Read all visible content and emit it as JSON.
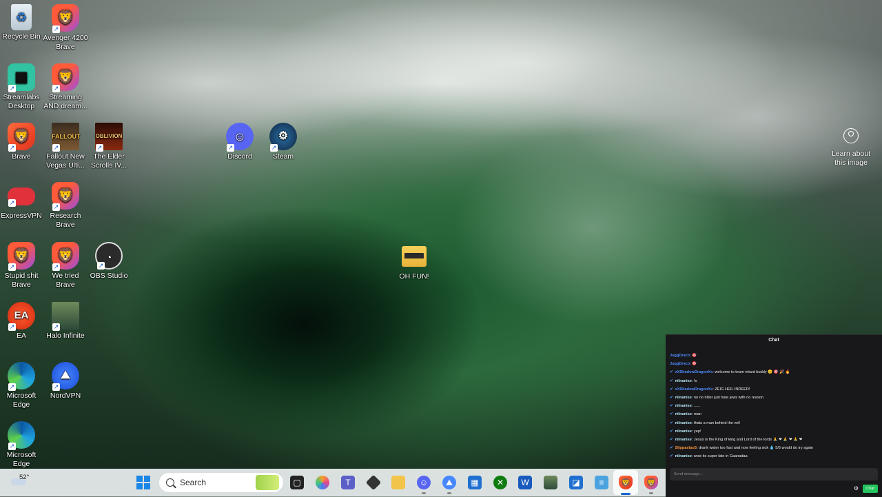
{
  "desktop": {
    "icons": [
      {
        "label": "Recycle Bin",
        "icon": "recycle-bin-icon"
      },
      {
        "label": "Avenger 4200 Brave",
        "icon": "brave-profile-icon"
      },
      {
        "label": "Streamlabs Desktop",
        "icon": "streamlabs-icon"
      },
      {
        "label": "Streaming AND dream...",
        "icon": "brave-profile-icon"
      },
      {
        "label": "Brave",
        "icon": "brave-icon"
      },
      {
        "label": "Fallout New Vegas Ulti...",
        "icon": "fallout-icon"
      },
      {
        "label": "The Elder Scrolls IV...",
        "icon": "oblivion-icon"
      },
      {
        "label": "ExpressVPN",
        "icon": "expressvpn-icon"
      },
      {
        "label": "Research Brave",
        "icon": "brave-profile-icon"
      },
      {
        "label": "Stupid shit Brave",
        "icon": "brave-profile-icon"
      },
      {
        "label": "We tried Brave",
        "icon": "brave-profile-icon"
      },
      {
        "label": "OBS Studio",
        "icon": "obs-icon"
      },
      {
        "label": "EA",
        "icon": "ea-icon"
      },
      {
        "label": "Halo Infinite",
        "icon": "halo-icon"
      },
      {
        "label": "Microsoft Edge",
        "icon": "edge-icon"
      },
      {
        "label": "NordVPN",
        "icon": "nordvpn-icon"
      },
      {
        "label": "Microsoft Edge",
        "icon": "edge-icon"
      },
      {
        "label": "Discord",
        "icon": "discord-icon"
      },
      {
        "label": "Steam",
        "icon": "steam-icon"
      },
      {
        "label": "OH FUN!",
        "icon": "folder-icon"
      }
    ],
    "learn_label": "Learn about this image"
  },
  "chat": {
    "title": "Chat",
    "messages": [
      {
        "user": "JuggDraco",
        "text": "🎯"
      },
      {
        "user": "JuggDraco",
        "text": "🎯"
      },
      {
        "user": "xXShadowDragonXx",
        "text": "welcome to team retard buddy 😊 🎯 🎉 🔥"
      },
      {
        "user": "nilnanise",
        "text": "!o"
      },
      {
        "user": "xXShadowDragonXx",
        "text": "ZEIG HEIL INDEED!"
      },
      {
        "user": "nilnanise",
        "text": "no no hitler just hate jews with no reason"
      },
      {
        "user": "nilnanise",
        "text": "......"
      },
      {
        "user": "nilnanise",
        "text": "man"
      },
      {
        "user": "nilnanise",
        "text": "thats a man behind the veil"
      },
      {
        "user": "nilnanise",
        "text": "yep!"
      },
      {
        "user": "nilnanise",
        "text": "Jesus is the King of king and Lord of the lords 🙏 ❤ 🙏 ❤ 🙏 ❤"
      },
      {
        "user": "Slippaslpu5",
        "text": "drank water too fast and now feeling sick 💧 5/5 would do try again"
      },
      {
        "user": "nilnanise",
        "text": "wow its super late in Caanadaa"
      }
    ],
    "input_placeholder": "Send message...",
    "send_label": "Chat"
  },
  "taskbar": {
    "weather_temp": "52°",
    "search_placeholder": "Search"
  },
  "colors": {
    "chat_bg": "#18181b",
    "send_green": "#22c55e",
    "start_blue": "#1a86e8"
  }
}
